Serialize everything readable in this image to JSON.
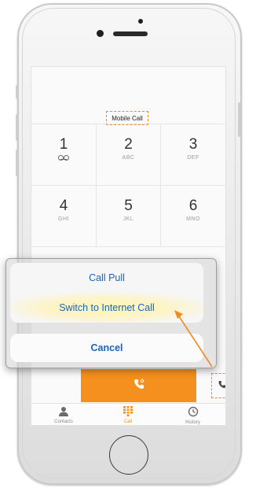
{
  "status_label": "Mobile Call",
  "keypad": {
    "rows": [
      [
        {
          "digit": "1",
          "letters": ""
        },
        {
          "digit": "2",
          "letters": "ABC"
        },
        {
          "digit": "3",
          "letters": "DEF"
        }
      ],
      [
        {
          "digit": "4",
          "letters": "GHI"
        },
        {
          "digit": "5",
          "letters": "JKL"
        },
        {
          "digit": "6",
          "letters": "MNO"
        }
      ]
    ]
  },
  "action_sheet": {
    "call_pull": "Call Pull",
    "switch_to_internet_call": "Switch to Internet Call",
    "cancel": "Cancel"
  },
  "call_bar": {
    "icon": "phone-icon"
  },
  "call_types": {
    "icon": "phone-list-icon"
  },
  "tabs": [
    {
      "label": "Contacts",
      "icon": "person-icon"
    },
    {
      "label": "Call",
      "icon": "keypad-icon",
      "active": true
    },
    {
      "label": "History",
      "icon": "clock-icon"
    }
  ],
  "colors": {
    "accent": "#f5901e",
    "link": "#1a64b6",
    "highlight": "#f08a24"
  }
}
